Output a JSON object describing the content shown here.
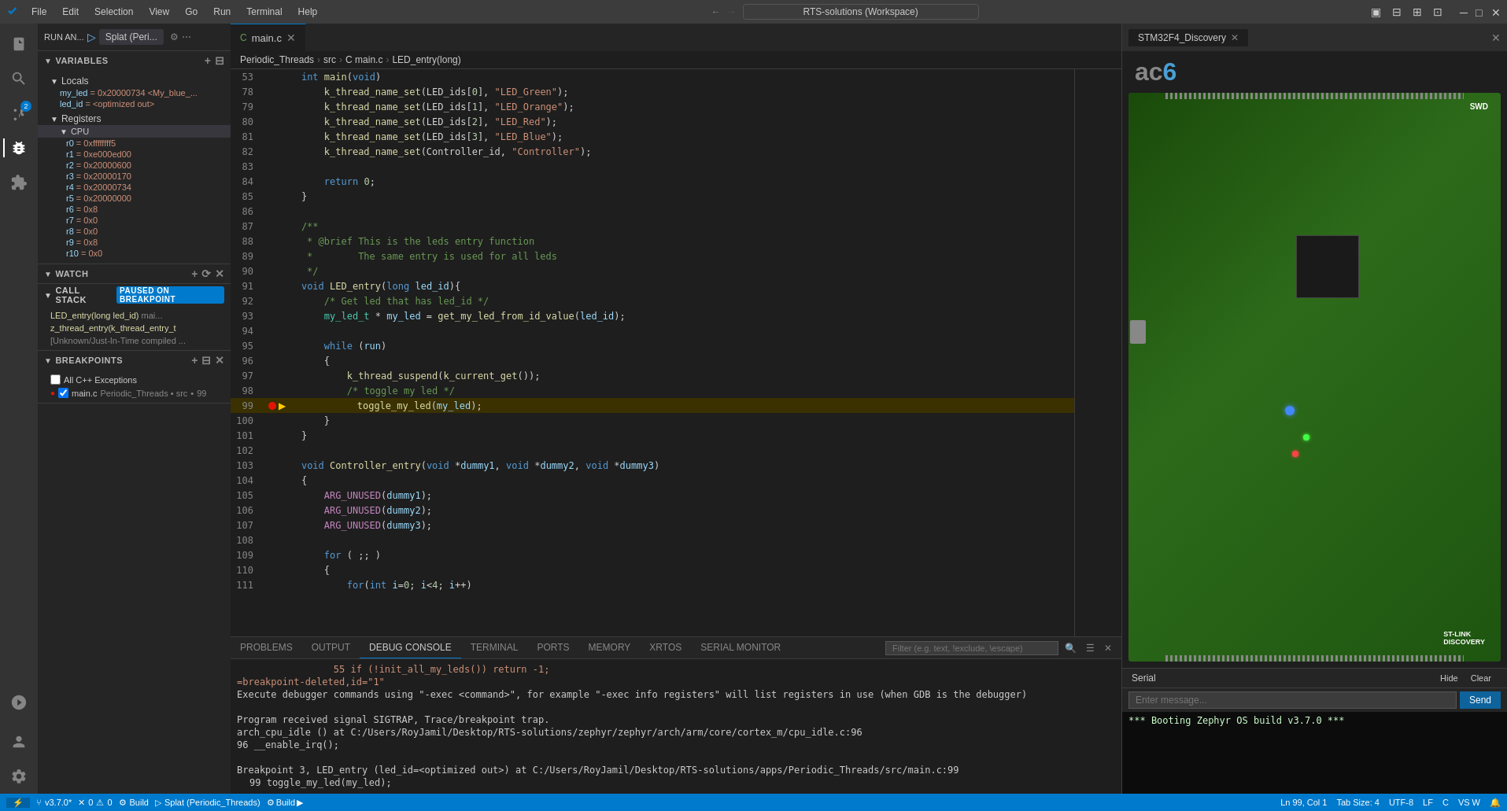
{
  "titlebar": {
    "title": "RTS-solutions (Workspace)",
    "menu": [
      "File",
      "Edit",
      "Selection",
      "View",
      "Go",
      "Run",
      "Terminal",
      "Help"
    ],
    "nav_back": "←",
    "nav_fwd": "→"
  },
  "activity": {
    "items": [
      {
        "name": "explorer",
        "icon": "⧉",
        "active": false
      },
      {
        "name": "search",
        "icon": "🔍",
        "active": false
      },
      {
        "name": "source-control",
        "icon": "⑂",
        "badge": "2",
        "active": false
      },
      {
        "name": "debug",
        "icon": "▷",
        "active": true
      },
      {
        "name": "extensions",
        "icon": "⊞",
        "active": false
      },
      {
        "name": "remote",
        "icon": "⚡",
        "active": false
      },
      {
        "name": "settings",
        "icon": "⚙",
        "active": false
      }
    ]
  },
  "sidebar": {
    "run_label": "RUN AN...",
    "debug_btn": "▷",
    "splat_btn": "Splat (Peri...",
    "variables_section": "VARIABLES",
    "locals_label": "Locals",
    "locals_items": [
      {
        "name": "my_led",
        "value": "= 0x20000734  <My_blue_..."
      },
      {
        "name": "led_id",
        "value": "= <optimized out>"
      }
    ],
    "registers_label": "Registers",
    "cpu_label": "CPU",
    "registers": [
      {
        "name": "r0",
        "value": "= 0xffffffff5"
      },
      {
        "name": "r1",
        "value": "= 0xe000ed00"
      },
      {
        "name": "r2",
        "value": "= 0x20000600"
      },
      {
        "name": "r3",
        "value": "= 0x20000170"
      },
      {
        "name": "r4",
        "value": "= 0x20000734"
      },
      {
        "name": "r5",
        "value": "= 0x20000000"
      },
      {
        "name": "r6",
        "value": "= 0x8"
      },
      {
        "name": "r7",
        "value": "= 0x0"
      },
      {
        "name": "r8",
        "value": "= 0x0"
      },
      {
        "name": "r9",
        "value": "= 0x8"
      },
      {
        "name": "r10",
        "value": "= 0x0"
      }
    ],
    "watch_label": "WATCH",
    "callstack_label": "CALL STACK",
    "callstack_badge": "Paused on breakpoint",
    "callstack_items": [
      {
        "fn": "LED_entry(long led_id)",
        "file": "mai..."
      },
      {
        "fn": "z_thread_entry(k_thread_entry_t",
        "file": ""
      },
      {
        "fn": "[Unknown/Just-In-Time compiled ...",
        "file": ""
      }
    ],
    "breakpoints_label": "BREAKPOINTS",
    "breakpoints": [
      {
        "label": "All C++ Exceptions",
        "checked": false
      },
      {
        "label": "main.c",
        "file": "Periodic_Threads • src",
        "line": "99",
        "checked": true
      }
    ]
  },
  "toolbar": {
    "run_label": "RUN AN...",
    "debug_label": "Splat (Peri...",
    "icons": [
      "▷",
      "⏭",
      "⟳",
      "↓",
      "↑",
      "↓↑",
      "◻",
      "⋯"
    ]
  },
  "editor": {
    "tab_name": "main.c",
    "breadcrumb": [
      "Periodic_Threads",
      "src",
      "C main.c",
      "LED_entry(long)"
    ],
    "lines": [
      {
        "num": 53,
        "code": "    int main(void)"
      },
      {
        "num": 78,
        "code": "        k_thread_name_set(LED_ids[0], \"LED_Green\");"
      },
      {
        "num": 79,
        "code": "        k_thread_name_set(LED_ids[1], \"LED_Orange\");"
      },
      {
        "num": 80,
        "code": "        k_thread_name_set(LED_ids[2], \"LED_Red\");"
      },
      {
        "num": 81,
        "code": "        k_thread_name_set(LED_ids[3], \"LED_Blue\");"
      },
      {
        "num": 82,
        "code": "        k_thread_name_set(Controller_id, \"Controller\");"
      },
      {
        "num": 83,
        "code": ""
      },
      {
        "num": 84,
        "code": "        return 0;"
      },
      {
        "num": 85,
        "code": "    }"
      },
      {
        "num": 86,
        "code": ""
      },
      {
        "num": 87,
        "code": "    /**"
      },
      {
        "num": 88,
        "code": "     * @brief This is the leds entry function"
      },
      {
        "num": 89,
        "code": "     *        The same entry is used for all leds"
      },
      {
        "num": 90,
        "code": "     */"
      },
      {
        "num": 91,
        "code": "    void LED_entry(long led_id){"
      },
      {
        "num": 92,
        "code": "        /* Get led that has led_id */"
      },
      {
        "num": 93,
        "code": "        my_led_t * my_led = get_my_led_from_id_value(led_id);"
      },
      {
        "num": 94,
        "code": ""
      },
      {
        "num": 95,
        "code": "        while (run)"
      },
      {
        "num": 96,
        "code": "        {"
      },
      {
        "num": 97,
        "code": "            k_thread_suspend(k_current_get());"
      },
      {
        "num": 98,
        "code": "            /* toggle my led */"
      },
      {
        "num": 99,
        "code": "            toggle_my_led(my_led);",
        "breakpoint": true,
        "current": true,
        "highlight": true
      },
      {
        "num": 100,
        "code": "        }"
      },
      {
        "num": 101,
        "code": "    }"
      },
      {
        "num": 102,
        "code": ""
      },
      {
        "num": 103,
        "code": "    void Controller_entry(void *dummy1, void *dummy2, void *dummy3)"
      },
      {
        "num": 104,
        "code": "    {"
      },
      {
        "num": 105,
        "code": "        ARG_UNUSED(dummy1);"
      },
      {
        "num": 106,
        "code": "        ARG_UNUSED(dummy2);"
      },
      {
        "num": 107,
        "code": "        ARG_UNUSED(dummy3);"
      },
      {
        "num": 108,
        "code": ""
      },
      {
        "num": 109,
        "code": "        for ( ;; )"
      },
      {
        "num": 110,
        "code": "        {"
      },
      {
        "num": 111,
        "code": "            for(int i=0; i<4; i++)"
      }
    ]
  },
  "stm_panel": {
    "tab": "STM32F4_Discovery",
    "logo": "ac",
    "logo_num": "6"
  },
  "serial": {
    "title": "Serial",
    "hide_btn": "Hide",
    "clear_btn": "Clear",
    "input_placeholder": "Enter message...",
    "send_btn": "Send",
    "output": "*** Booting Zephyr OS build v3.7.0 ***"
  },
  "bottom_panel": {
    "tabs": [
      "PROBLEMS",
      "OUTPUT",
      "DEBUG CONSOLE",
      "TERMINAL",
      "PORTS",
      "MEMORY",
      "XRTOS",
      "SERIAL MONITOR"
    ],
    "active_tab": "DEBUG CONSOLE",
    "filter_placeholder": "Filter (e.g. text, !exclude, \\escape)",
    "lines": [
      {
        "text": "        if (!init_all_my_leds()) return -1;",
        "type": "warning",
        "num": "55"
      },
      {
        "text": "=breakpoint-deleted,id=\"1\"",
        "type": "warning"
      },
      {
        "text": "Execute debugger commands using \"-exec <command>\", for example \"-exec info registers\" will list registers in use (when GDB is the debugger)",
        "type": "normal"
      },
      {
        "text": "",
        "type": "normal"
      },
      {
        "text": "Program received signal SIGTRAP, Trace/breakpoint trap.",
        "type": "normal"
      },
      {
        "text": "arch_cpu_idle () at C:/Users/RoyJamil/Desktop/RTS-solutions/zephyr/zephyr/arch/arm/core/cortex_m/cpu_idle.c:96",
        "type": "normal"
      },
      {
        "text": "96            __enable_irq();",
        "type": "normal"
      },
      {
        "text": "",
        "type": "normal"
      },
      {
        "text": "Breakpoint 3, LED_entry (led_id=<optimized out>) at C:/Users/RoyJamil/Desktop/RTS-solutions/apps/Periodic_Threads/src/main.c:99",
        "type": "normal"
      },
      {
        "text": "99            toggle_my_led(my_led);",
        "type": "normal"
      }
    ]
  },
  "statusbar": {
    "git_branch": "v3.7.0*",
    "errors": "0",
    "warnings": "0",
    "build_label": "Build",
    "splat_label": "Splat (Periodic_Threads)",
    "position": "Ln 99, Col 1",
    "tab_size": "Tab Size: 4",
    "encoding": "UTF-8",
    "eol": "LF",
    "lang": "C",
    "arch": "VS W"
  }
}
